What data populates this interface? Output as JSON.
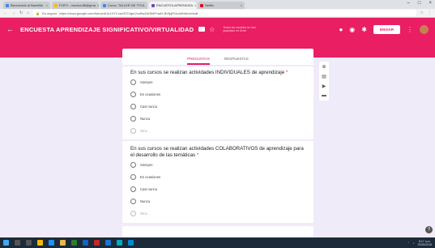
{
  "browser": {
    "tabs": [
      {
        "label": "Bienvenido al Bachiller",
        "active": false,
        "color": "#4285f4"
      },
      {
        "label": "FOFO - monica.88@gma",
        "active": false,
        "color": "#fbbc04"
      },
      {
        "label": "Curso: TALLER DE TITUL",
        "active": false,
        "color": "#4285f4"
      },
      {
        "label": "ENCUESTA APRENDIZA",
        "active": true,
        "color": "#7248b9"
      },
      {
        "label": "Netflix",
        "active": false,
        "color": "#e50914"
      }
    ],
    "secure_label": "Es seguro",
    "url": "https://docs.google.com/forms/d/1e1VYCcaXEG2gmVvvBw2dGBEFoaH-BVfpjRGoA4hNeve/edit"
  },
  "header": {
    "title": "ENCUESTA APRENDIZAJE SIGNIFICATIVO/VIRTUALIDAD",
    "saved_text": "Todos los cambios se han guardado en Drive",
    "send_label": "ENVIAR"
  },
  "tabs": {
    "questions": "PREGUNTAS",
    "responses": "RESPUESTAS"
  },
  "questions": [
    {
      "text": "En sus cursos se realizan actividades INDIVIDUALES de aprendizaje",
      "options": [
        "Siempre",
        "En ocasiones",
        "Casi nunca",
        "Nunca"
      ],
      "other": "Otra..."
    },
    {
      "text": "En sus cursos se realizan actividades COLABORATIVOS de aprendizaje para el desarrollo de las temáticas",
      "options": [
        "Siempre",
        "En ocasiones",
        "Casi nunca",
        "Nunca"
      ],
      "other": "Otra..."
    }
  ],
  "required_mark": "*",
  "drag_handle": "⋮⋮",
  "help": "?",
  "clock": {
    "time": "8:17 a.m.",
    "date": "23/05/2018"
  },
  "colors": {
    "accent": "#e91e63",
    "background": "#f0ebf8"
  }
}
